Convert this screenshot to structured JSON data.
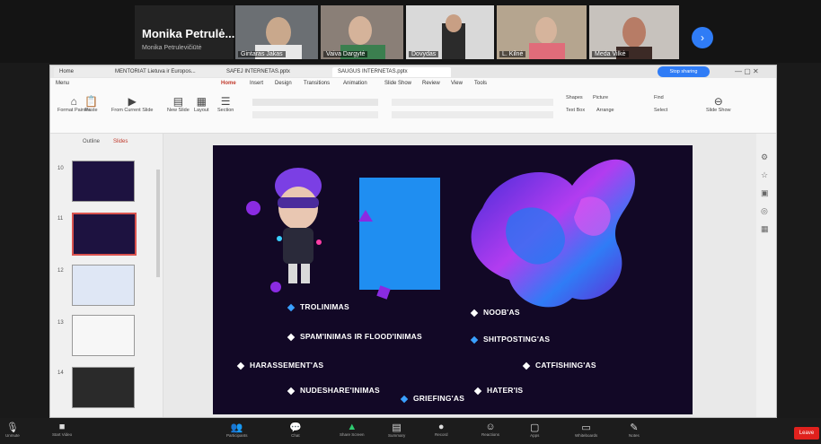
{
  "meeting": {
    "speaker_name": "Monika Petrulė...",
    "speaker_subtitle": "Monika Petrulevičiūtė",
    "participants": [
      "Gintaras Jakas",
      "Vaiva Dargytė",
      "Dovydas",
      "L. Kilnė",
      "Meda Vilkė"
    ],
    "controls": [
      "Unmute",
      "Start Video",
      "Participants",
      "Chat",
      "Share Screen",
      "Summary",
      "Record",
      "Reactions",
      "Apps",
      "Whiteboards",
      "Notes"
    ],
    "leave_label": "Leave"
  },
  "app": {
    "tabs": [
      "Home",
      "MENTORIAT Lietuva ir Europos...",
      "SAFEJ INTERNETAS.pptx",
      "SAUGUS INTERNETAS.pptx"
    ],
    "menu": [
      "Menu",
      "Home",
      "Insert",
      "Design",
      "Transitions",
      "Animation",
      "Slide Show",
      "Review",
      "View",
      "Tools"
    ],
    "share_label": "Stop sharing",
    "ribbon_items": [
      "Format Painter",
      "Paste",
      "From Current Slide",
      "New Slide",
      "Layout",
      "Section",
      "Reset",
      "Shapes",
      "Picture",
      "Text Box",
      "Arrange",
      "Find",
      "Replace",
      "Select",
      "Slide Show"
    ],
    "panel_tabs": [
      "Outline",
      "Slides"
    ],
    "slide_numbers": [
      "10",
      "11",
      "12",
      "13",
      "14"
    ]
  },
  "slide": {
    "keywords": [
      {
        "text": "TROLINIMAS",
        "color": "#3aa0ff"
      },
      {
        "text": "SPAM'INIMAS IR FLOOD'INIMAS",
        "color": "#ffffff"
      },
      {
        "text": "HARASSEMENT'AS",
        "color": "#ffffff"
      },
      {
        "text": "NUDESHARE'INIMAS",
        "color": "#ffffff"
      },
      {
        "text": "GRIEFING'AS",
        "color": "#3aa0ff"
      },
      {
        "text": "NOOB'AS",
        "color": "#ffffff"
      },
      {
        "text": "SHITPOSTING'AS",
        "color": "#3aa0ff"
      },
      {
        "text": "CATFISHING'AS",
        "color": "#ffffff"
      },
      {
        "text": "HATER'IS",
        "color": "#ffffff"
      }
    ],
    "accent_blue": "#1f8ef1",
    "accent_purple": "#8a2be2"
  }
}
